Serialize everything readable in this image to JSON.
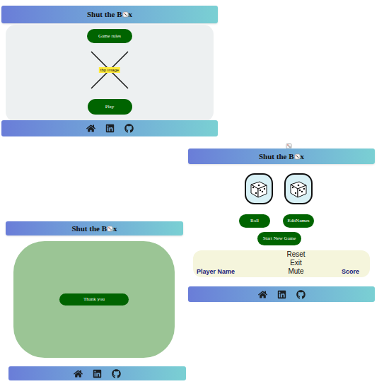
{
  "header": {
    "title_start": "Shut the B",
    "title_end": "x"
  },
  "start_screen": {
    "rules_button": "Game rules",
    "image_label": "tbp image",
    "play_button": "Play"
  },
  "thanks_screen": {
    "button": "Thank you"
  },
  "game_screen": {
    "buttons": [
      "Roll",
      "EditNames"
    ],
    "new_game_button": "Start New Game",
    "scoreboard": {
      "left_column": "Player Name",
      "menu": [
        "Reset",
        "Exit",
        "Mute"
      ],
      "right_column": "Score"
    }
  }
}
